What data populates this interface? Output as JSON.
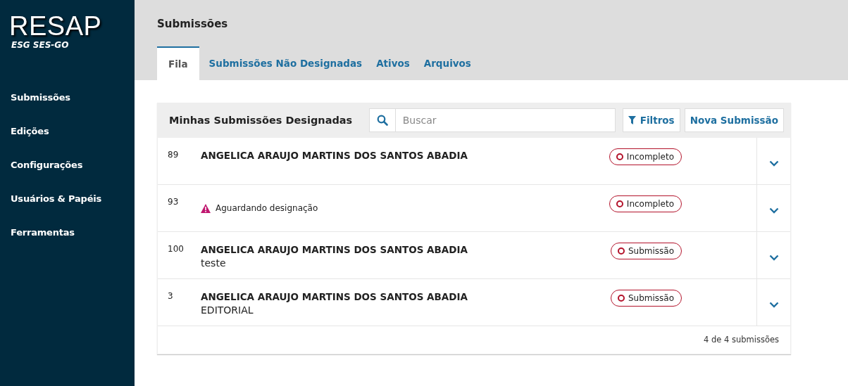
{
  "logo": {
    "title": "RESAP",
    "subtitle": "ESG SES-GO"
  },
  "sidebar": {
    "items": [
      {
        "label": "Submissões"
      },
      {
        "label": "Edições"
      },
      {
        "label": "Configurações"
      },
      {
        "label": "Usuários & Papéis"
      },
      {
        "label": "Ferramentas"
      }
    ]
  },
  "page_title": "Submissões",
  "tabs": [
    {
      "label": "Fila",
      "selected": true
    },
    {
      "label": "Submissões Não Designadas",
      "selected": false
    },
    {
      "label": "Ativos",
      "selected": false
    },
    {
      "label": "Arquivos",
      "selected": false
    }
  ],
  "panel": {
    "title": "Minhas Submissões Designadas",
    "search": {
      "placeholder": "Buscar"
    },
    "filter_button": "Filtros",
    "new_button": "Nova Submissão"
  },
  "rows": [
    {
      "kind": "submission",
      "id": "89",
      "author": "ANGELICA ARAUJO MARTINS DOS SANTOS ABADIA",
      "stage": "Incompleto"
    },
    {
      "kind": "warning",
      "id": "93",
      "notice": "Aguardando designação",
      "stage": "Incompleto"
    },
    {
      "kind": "submission",
      "id": "100",
      "author": "ANGELICA ARAUJO MARTINS DOS SANTOS ABADIA",
      "title": "teste",
      "stage": "Submissão"
    },
    {
      "kind": "submission",
      "id": "3",
      "author": "ANGELICA ARAUJO MARTINS DOS SANTOS ABADIA",
      "title": "EDITORIAL",
      "stage": "Submissão"
    }
  ],
  "footer": "4 de 4 submissões"
}
